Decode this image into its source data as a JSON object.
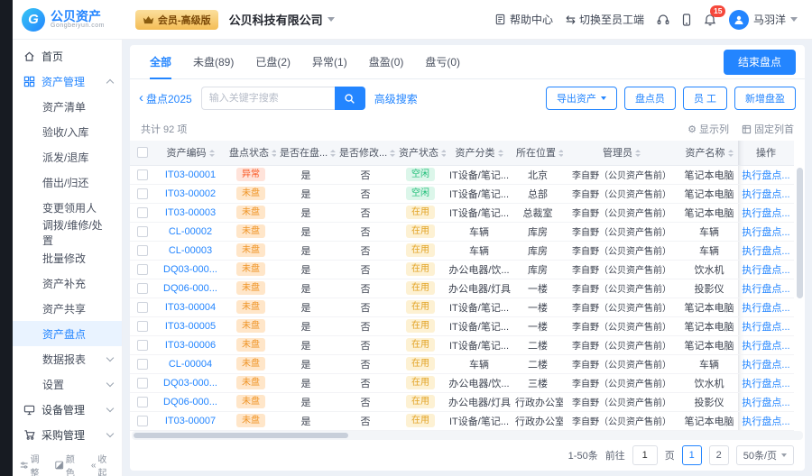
{
  "accent": "#2385ff",
  "topbar": {
    "brand_name": "公贝资产",
    "brand_sub": "Gongbeiyun.com",
    "member_badge": "会员-高级版",
    "company": "公贝科技有限公司",
    "help": "帮助中心",
    "switch_staff": "切换至员工端",
    "notice_count": "15",
    "username": "马羽洋"
  },
  "sidebar": {
    "home": "首页",
    "asset_mgmt": "资产管理",
    "sub_items": [
      {
        "label": "资产清单",
        "cls": "plain"
      },
      {
        "label": "验收/入库",
        "cls": "plain"
      },
      {
        "label": "派发/退库",
        "cls": "plain"
      },
      {
        "label": "借出/归还",
        "cls": "plain"
      },
      {
        "label": "变更领用人",
        "cls": "plain"
      },
      {
        "label": "调拨/维修/处置",
        "cls": "plain"
      },
      {
        "label": "批量修改",
        "cls": "plain"
      },
      {
        "label": "资产补充",
        "cls": "plain"
      },
      {
        "label": "资产共享",
        "cls": "plain"
      },
      {
        "label": "资产盘点",
        "cls": "active"
      },
      {
        "label": "数据报表",
        "cls": "expandable"
      },
      {
        "label": "设置",
        "cls": "expandable"
      }
    ],
    "device_mgmt": "设备管理",
    "purchase_mgmt": "采购管理",
    "footer": {
      "adjust": "调整",
      "color": "颜色",
      "collapse": "收起"
    }
  },
  "tabs": [
    {
      "label": "全部",
      "cls": "active"
    },
    {
      "label": "未盘(89)",
      "cls": "plain"
    },
    {
      "label": "已盘(2)",
      "cls": "plain"
    },
    {
      "label": "异常(1)",
      "cls": "plain"
    },
    {
      "label": "盘盈(0)",
      "cls": "plain"
    },
    {
      "label": "盘亏(0)",
      "cls": "plain"
    }
  ],
  "toolbar": {
    "end_btn": "结束盘点",
    "back_link": "盘点2025",
    "search_placeholder": "输入关键字搜索",
    "advanced_search": "高级搜索",
    "export_btn": "导出资产",
    "staff_btn": "盘点员",
    "employee_btn": "员 工",
    "surplus_btn": "新增盘盈"
  },
  "table": {
    "summary": "共计 92 项",
    "show_cols": "显示列",
    "fix_cols": "固定列首",
    "headers": [
      "资产编码",
      "盘点状态",
      "是否在盘...",
      "是否修改...",
      "资产状态",
      "资产分类",
      "所在位置",
      "管理员",
      "资产名称",
      "操作"
    ],
    "rows": [
      {
        "code": "IT03-00001",
        "pan": "异常",
        "pan_cls": "tag-abnormal",
        "in_scope": "是",
        "modified": "否",
        "status": "空闲",
        "status_cls": "tag-idle",
        "category": "IT设备/笔记...",
        "location": "北京",
        "manager": "李自野（公贝资产售前）",
        "name": "笔记本电脑",
        "action": "执行盘点..."
      },
      {
        "code": "IT03-00002",
        "pan": "未盘",
        "pan_cls": "tag-unpan",
        "in_scope": "是",
        "modified": "否",
        "status": "空闲",
        "status_cls": "tag-idle",
        "category": "IT设备/笔记...",
        "location": "总部",
        "manager": "李自野（公贝资产售前）",
        "name": "笔记本电脑",
        "action": "执行盘点..."
      },
      {
        "code": "IT03-00003",
        "pan": "未盘",
        "pan_cls": "tag-unpan",
        "in_scope": "是",
        "modified": "否",
        "status": "在用",
        "status_cls": "tag-inuse",
        "category": "IT设备/笔记...",
        "location": "总裁室",
        "manager": "李自野（公贝资产售前）",
        "name": "笔记本电脑",
        "action": "执行盘点..."
      },
      {
        "code": "CL-00002",
        "pan": "未盘",
        "pan_cls": "tag-unpan",
        "in_scope": "是",
        "modified": "否",
        "status": "在用",
        "status_cls": "tag-inuse",
        "category": "车辆",
        "location": "库房",
        "manager": "李自野（公贝资产售前）",
        "name": "车辆",
        "action": "执行盘点..."
      },
      {
        "code": "CL-00003",
        "pan": "未盘",
        "pan_cls": "tag-unpan",
        "in_scope": "是",
        "modified": "否",
        "status": "在用",
        "status_cls": "tag-inuse",
        "category": "车辆",
        "location": "库房",
        "manager": "李自野（公贝资产售前）",
        "name": "车辆",
        "action": "执行盘点..."
      },
      {
        "code": "DQ03-000...",
        "pan": "未盘",
        "pan_cls": "tag-unpan",
        "in_scope": "是",
        "modified": "否",
        "status": "在用",
        "status_cls": "tag-inuse",
        "category": "办公电器/饮...",
        "location": "库房",
        "manager": "李自野（公贝资产售前）",
        "name": "饮水机",
        "action": "执行盘点..."
      },
      {
        "code": "DQ06-000...",
        "pan": "未盘",
        "pan_cls": "tag-unpan",
        "in_scope": "是",
        "modified": "否",
        "status": "在用",
        "status_cls": "tag-inuse",
        "category": "办公电器/灯具",
        "location": "一楼",
        "manager": "李自野（公贝资产售前）",
        "name": "投影仪",
        "action": "执行盘点..."
      },
      {
        "code": "IT03-00004",
        "pan": "未盘",
        "pan_cls": "tag-unpan",
        "in_scope": "是",
        "modified": "否",
        "status": "在用",
        "status_cls": "tag-inuse",
        "category": "IT设备/笔记...",
        "location": "一楼",
        "manager": "李自野（公贝资产售前）",
        "name": "笔记本电脑",
        "action": "执行盘点..."
      },
      {
        "code": "IT03-00005",
        "pan": "未盘",
        "pan_cls": "tag-unpan",
        "in_scope": "是",
        "modified": "否",
        "status": "在用",
        "status_cls": "tag-inuse",
        "category": "IT设备/笔记...",
        "location": "一楼",
        "manager": "李自野（公贝资产售前）",
        "name": "笔记本电脑",
        "action": "执行盘点..."
      },
      {
        "code": "IT03-00006",
        "pan": "未盘",
        "pan_cls": "tag-unpan",
        "in_scope": "是",
        "modified": "否",
        "status": "在用",
        "status_cls": "tag-inuse",
        "category": "IT设备/笔记...",
        "location": "二楼",
        "manager": "李自野（公贝资产售前）",
        "name": "笔记本电脑",
        "action": "执行盘点..."
      },
      {
        "code": "CL-00004",
        "pan": "未盘",
        "pan_cls": "tag-unpan",
        "in_scope": "是",
        "modified": "否",
        "status": "在用",
        "status_cls": "tag-inuse",
        "category": "车辆",
        "location": "二楼",
        "manager": "李自野（公贝资产售前）",
        "name": "车辆",
        "action": "执行盘点..."
      },
      {
        "code": "DQ03-000...",
        "pan": "未盘",
        "pan_cls": "tag-unpan",
        "in_scope": "是",
        "modified": "否",
        "status": "在用",
        "status_cls": "tag-inuse",
        "category": "办公电器/饮...",
        "location": "三楼",
        "manager": "李自野（公贝资产售前）",
        "name": "饮水机",
        "action": "执行盘点..."
      },
      {
        "code": "DQ06-000...",
        "pan": "未盘",
        "pan_cls": "tag-unpan",
        "in_scope": "是",
        "modified": "否",
        "status": "在用",
        "status_cls": "tag-inuse",
        "category": "办公电器/灯具",
        "location": "行政办公室",
        "manager": "李自野（公贝资产售前）",
        "name": "投影仪",
        "action": "执行盘点..."
      },
      {
        "code": "IT03-00007",
        "pan": "未盘",
        "pan_cls": "tag-unpan",
        "in_scope": "是",
        "modified": "否",
        "status": "在用",
        "status_cls": "tag-inuse",
        "category": "IT设备/笔记...",
        "location": "行政办公室",
        "manager": "李自野（公贝资产售前）",
        "name": "笔记本电脑",
        "action": "执行盘点..."
      }
    ]
  },
  "pagination": {
    "range": "1-50条",
    "goto": "前往",
    "goto_value": "1",
    "page_unit": "页",
    "page1": "1",
    "page2": "2",
    "page_size": "50条/页"
  }
}
